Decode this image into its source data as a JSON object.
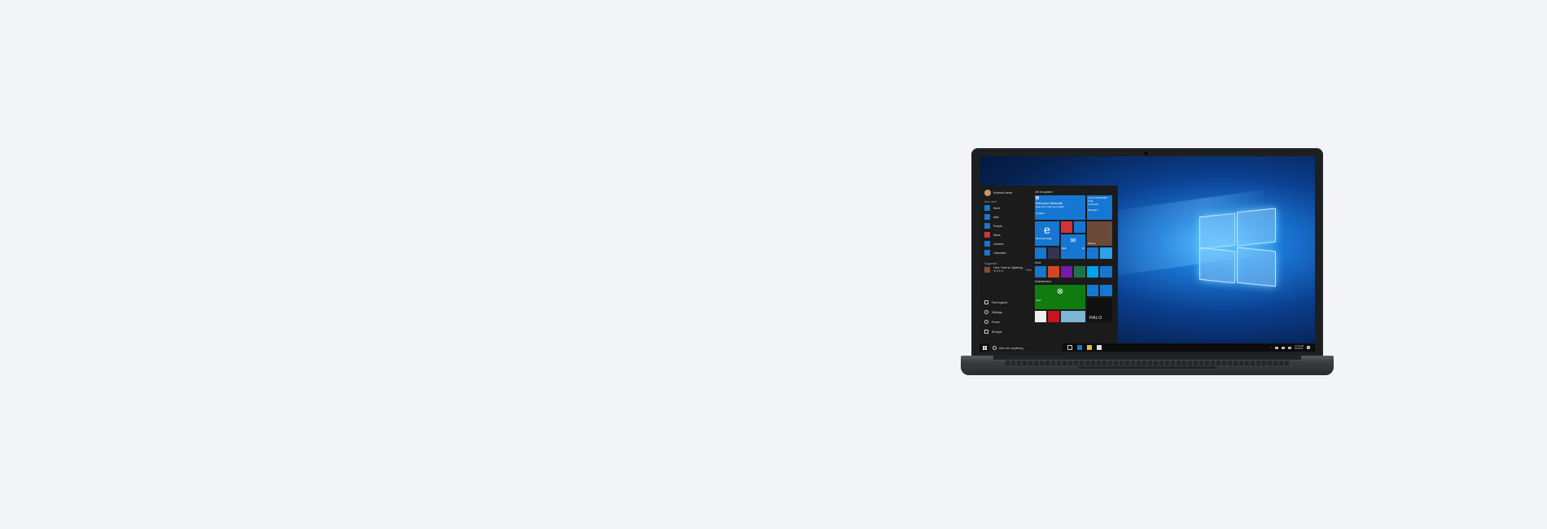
{
  "user": {
    "name": "Miranda Vance"
  },
  "start_menu": {
    "most_used_label": "Most used",
    "apps": [
      {
        "label": "Word",
        "icon": "word-icon",
        "color": "#1677d2"
      },
      {
        "label": "Mail",
        "icon": "mail-icon",
        "color": "#1677d2"
      },
      {
        "label": "People",
        "icon": "people-icon",
        "color": "#1677d2"
      },
      {
        "label": "News",
        "icon": "news-icon",
        "color": "#d13438"
      },
      {
        "label": "Camera",
        "icon": "camera-icon",
        "color": "#1677d2"
      },
      {
        "label": "Calculator",
        "icon": "calculator-icon",
        "color": "#1677d2"
      }
    ],
    "suggested_label": "Suggested",
    "suggested_app": {
      "label": "Cars: Fast as Lightning",
      "rating": "★★★★",
      "badge": "Free"
    },
    "bottom_items": [
      {
        "label": "File Explorer",
        "icon": "folder-icon"
      },
      {
        "label": "Settings",
        "icon": "gear-icon"
      },
      {
        "label": "Power",
        "icon": "power-icon"
      },
      {
        "label": "All Apps",
        "icon": "apps-icon"
      }
    ]
  },
  "tiles": {
    "group_glance": "Life at a glance",
    "cortana_title": "Welcome Miranda!",
    "cortana_sub": "How can I help you today?",
    "cortana_label": "Cortana",
    "calendar_text": "Lunch with Barbra",
    "calendar_sub": "Café",
    "calendar_time": "11:00 AM",
    "calendar_day": "Monday 6",
    "edge_label": "Microsoft Edge",
    "mail_label": "Mail",
    "mail_count": "10",
    "photos_label": "Photos",
    "group_work": "Work",
    "group_entertainment": "Entertainment",
    "xbox_label": "Xbox",
    "halo_label": "HALO"
  },
  "taskbar": {
    "search_placeholder": "Ask me anything",
    "time": "10:30 AM",
    "date": "6/6/2015"
  },
  "colors": {
    "accent": "#1677d2",
    "start_bg": "#1b1b1b",
    "taskbar_bg": "#0c0c0c",
    "xbox_green": "#107c10"
  }
}
